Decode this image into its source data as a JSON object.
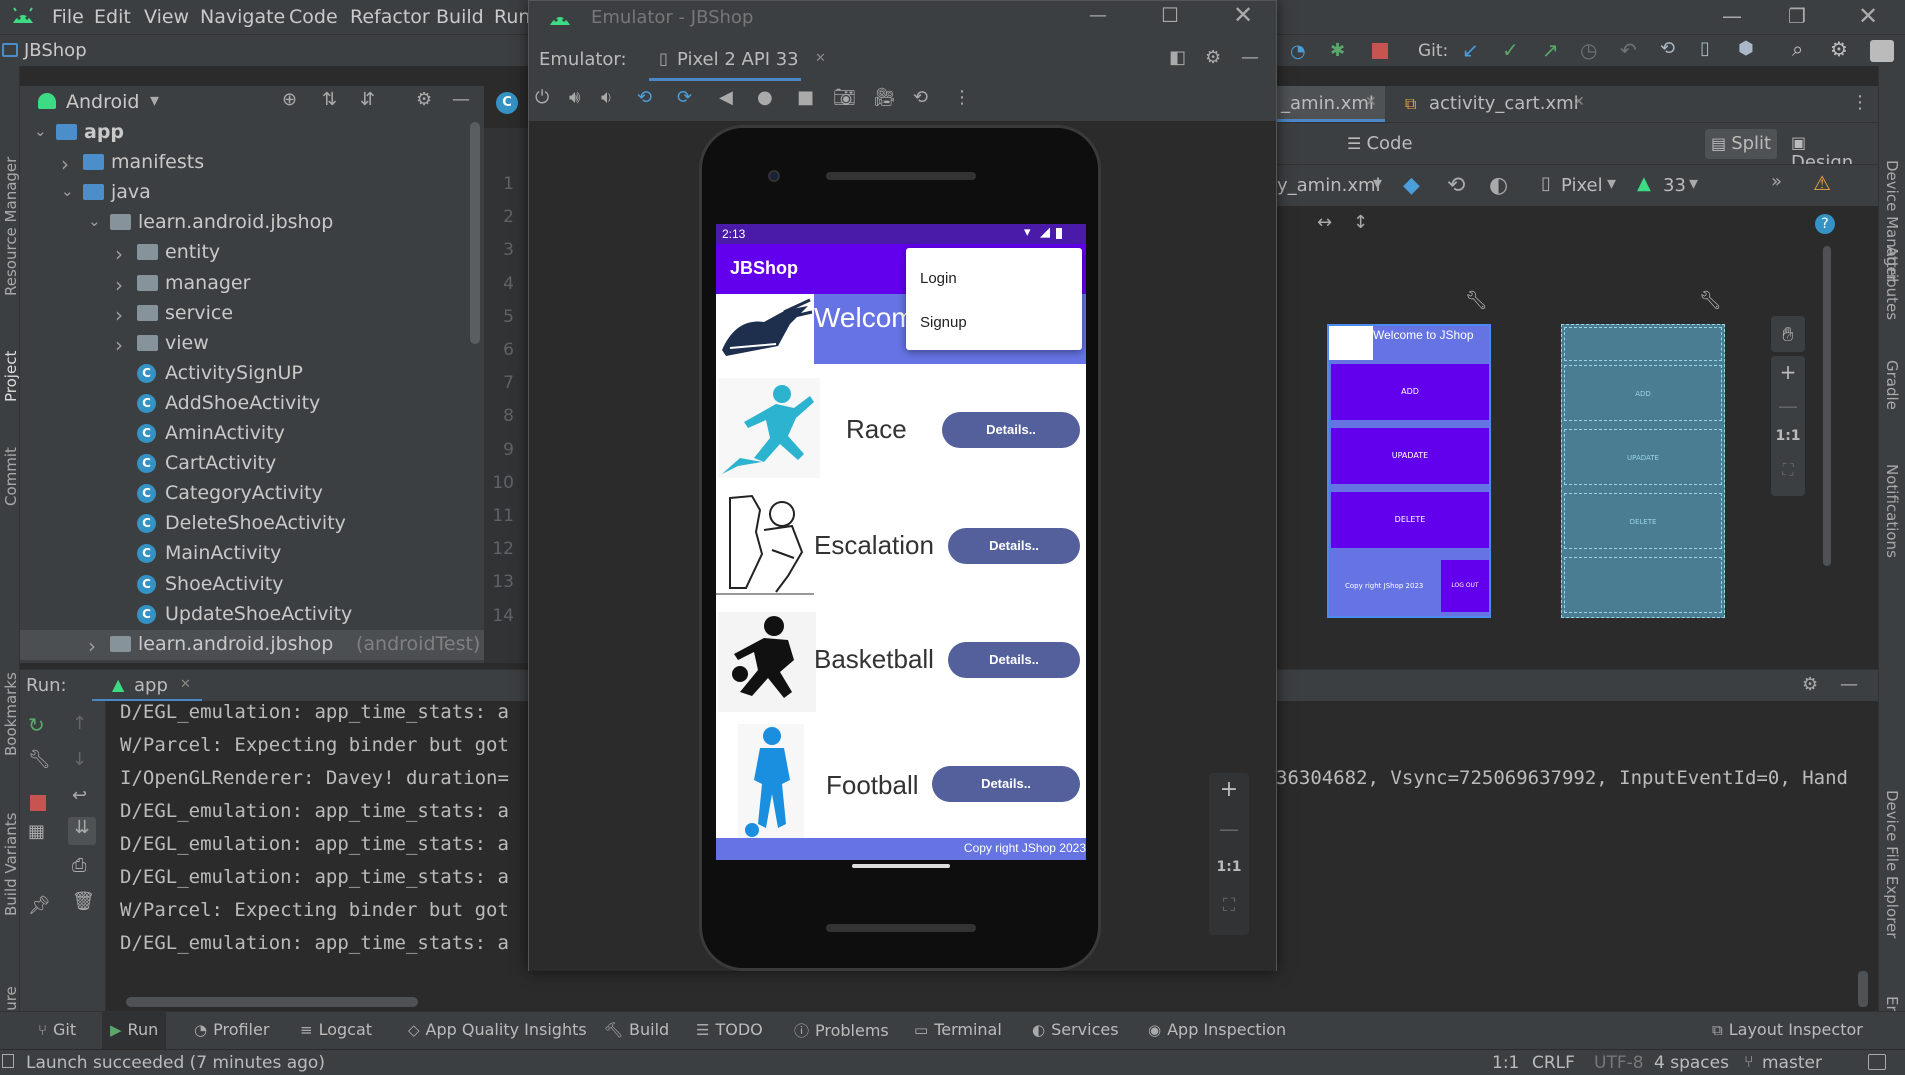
{
  "ide": {
    "menu": [
      "File",
      "Edit",
      "View",
      "Navigate",
      "Code",
      "Refactor",
      "Build",
      "Run"
    ],
    "project_name": "JBShop",
    "git_label": "Git:",
    "left_strip": [
      "Resource Manager",
      "Project",
      "Commit",
      "Bookmarks",
      "Build Variants",
      "Structure"
    ],
    "right_strip": [
      "Device Manager",
      "Attributes",
      "Gradle",
      "Notifications",
      "Device File Explorer",
      "Emulator"
    ]
  },
  "project_panel": {
    "view_selector": "Android",
    "tree": [
      {
        "label": "app",
        "type": "module",
        "indent": 0,
        "expanded": true
      },
      {
        "label": "manifests",
        "type": "folder",
        "indent": 1,
        "expanded": false
      },
      {
        "label": "java",
        "type": "folder",
        "indent": 1,
        "expanded": true
      },
      {
        "label": "learn.android.jbshop",
        "type": "package",
        "indent": 2,
        "expanded": true
      },
      {
        "label": "entity",
        "type": "package",
        "indent": 3,
        "expanded": false
      },
      {
        "label": "manager",
        "type": "package",
        "indent": 3,
        "expanded": false
      },
      {
        "label": "service",
        "type": "package",
        "indent": 3,
        "expanded": false
      },
      {
        "label": "view",
        "type": "package",
        "indent": 3,
        "expanded": false
      },
      {
        "label": "ActivitySignUP",
        "type": "class",
        "indent": 3
      },
      {
        "label": "AddShoeActivity",
        "type": "class",
        "indent": 3
      },
      {
        "label": "AminActivity",
        "type": "class",
        "indent": 3
      },
      {
        "label": "CartActivity",
        "type": "class",
        "indent": 3
      },
      {
        "label": "CategoryActivity",
        "type": "class",
        "indent": 3
      },
      {
        "label": "DeleteShoeActivity",
        "type": "class",
        "indent": 3
      },
      {
        "label": "MainActivity",
        "type": "class",
        "indent": 3
      },
      {
        "label": "ShoeActivity",
        "type": "class",
        "indent": 3
      },
      {
        "label": "UpdateShoeActivity",
        "type": "class",
        "indent": 3
      },
      {
        "label": "learn.android.jbshop",
        "suffix": "(androidTest)",
        "type": "package",
        "indent": 2,
        "expanded": false,
        "selected": true
      }
    ]
  },
  "editor": {
    "line_numbers": [
      "1",
      "2",
      "3",
      "4",
      "5",
      "6",
      "7",
      "8",
      "9",
      "10",
      "11",
      "12",
      "13",
      "14"
    ],
    "tabs": [
      "activity_amin.xml",
      "activity_cart.xml"
    ],
    "tab_visible_text": "_amin.xml",
    "view_modes": [
      "Code",
      "Split",
      "Design"
    ],
    "active_mode": "Split",
    "design_toolbar": {
      "file": "y_amin.xml",
      "device": "Pixel",
      "api": "33"
    },
    "preview": {
      "header": "Welcome to JShop",
      "buttons": [
        "ADD",
        "UPADATE",
        "DELETE"
      ],
      "footer": "Copy right JShop 2023",
      "footer_btn": "LOG OUT"
    }
  },
  "run_panel": {
    "label": "Run:",
    "config": "app",
    "logs": [
      "D/EGL_emulation: app_time_stats: a",
      "W/Parcel: Expecting binder but got",
      "I/OpenGLRenderer: Davey! duration=",
      "D/EGL_emulation: app_time_stats: a",
      "D/EGL_emulation: app_time_stats: a",
      "D/EGL_emulation: app_time_stats: a",
      "W/Parcel: Expecting binder but got",
      "D/EGL_emulation: app_time_stats: a"
    ],
    "log_tail": "36304682, Vsync=725069637992, InputEventId=0, Hand"
  },
  "bottom_tabs": [
    "Git",
    "Run",
    "Profiler",
    "Logcat",
    "App Quality Insights",
    "Build",
    "TODO",
    "Problems",
    "Terminal",
    "Services",
    "App Inspection"
  ],
  "right_bottom_tab": "Layout Inspector",
  "status": {
    "message": "Launch succeeded (7 minutes ago)",
    "position": "1:1",
    "line_sep": "CRLF",
    "encoding": "UTF-8",
    "indent": "4 spaces",
    "branch": "master"
  },
  "emulator": {
    "title": "Emulator - JBShop",
    "label": "Emulator:",
    "device_tab": "Pixel 2 API 33",
    "zoom_actual": "1:1"
  },
  "phone_app": {
    "time": "2:13",
    "app_title": "JBShop",
    "welcome": "Welcom",
    "menu": [
      "Login",
      "Signup"
    ],
    "categories": [
      {
        "name": "Race",
        "button": "Details..",
        "color": "#2bb3d0"
      },
      {
        "name": "Escalation",
        "button": "Details..",
        "color": "#222222"
      },
      {
        "name": "Basketball",
        "button": "Details..",
        "color": "#111111"
      },
      {
        "name": "Football",
        "button": "Details..",
        "color": "#1a8fe0"
      }
    ],
    "footer": "Copy right JShop 2023",
    "colors": {
      "statusbar": "#4a1aa8",
      "appbar": "#6200ee",
      "header": "#6573e3",
      "footer": "#6573e3",
      "button": "#53609c"
    }
  }
}
